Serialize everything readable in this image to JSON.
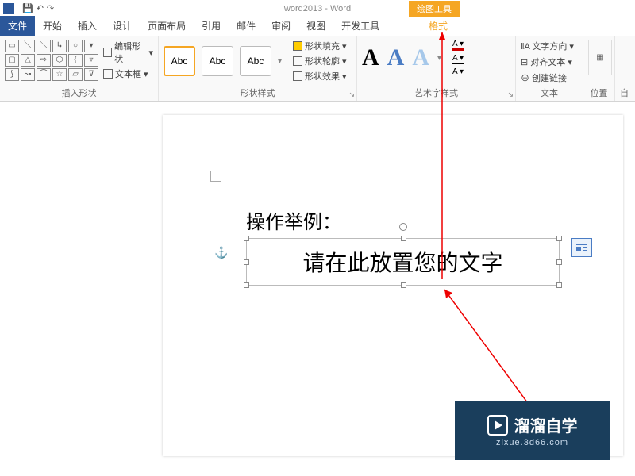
{
  "titlebar": {
    "title": "word2013 - Word",
    "drawing_tools": "绘图工具"
  },
  "tabs": {
    "file": "文件",
    "home": "开始",
    "insert": "插入",
    "design": "设计",
    "layout": "页面布局",
    "references": "引用",
    "mailings": "邮件",
    "review": "审阅",
    "view": "视图",
    "developer": "开发工具",
    "format": "格式"
  },
  "ribbon": {
    "shapes": {
      "edit_shape": "编辑形状",
      "text_box": "文本框",
      "label": "插入形状"
    },
    "shape_styles": {
      "abc": "Abc",
      "fill": "形状填充",
      "outline": "形状轮廓",
      "effects": "形状效果",
      "label": "形状样式"
    },
    "wordart": {
      "label": "艺术字样式"
    },
    "text": {
      "direction": "文字方向",
      "align": "对齐文本",
      "link": "创建链接",
      "label": "文本"
    },
    "position": {
      "label": "位置"
    },
    "wrap": {
      "label": "自"
    }
  },
  "document": {
    "example_label": "操作举例：",
    "placeholder_text": "请在此放置您的文字"
  },
  "watermark": {
    "brand": "溜溜自学",
    "url": "zixue.3d66.com"
  }
}
